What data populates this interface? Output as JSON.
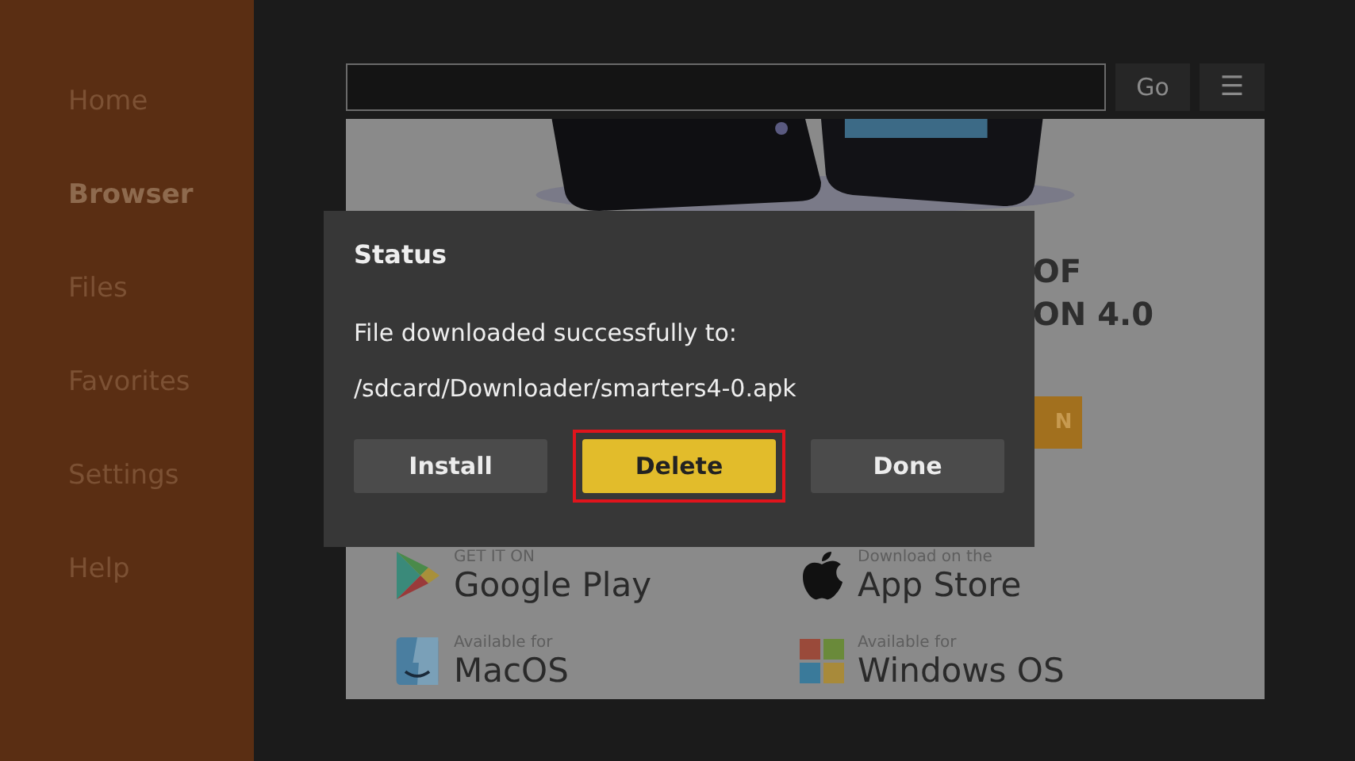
{
  "sidebar": {
    "items": [
      {
        "label": "Home",
        "selected": false
      },
      {
        "label": "Browser",
        "selected": true
      },
      {
        "label": "Files",
        "selected": false
      },
      {
        "label": "Favorites",
        "selected": false
      },
      {
        "label": "Settings",
        "selected": false
      },
      {
        "label": "Help",
        "selected": false
      }
    ]
  },
  "toolbar": {
    "go": "Go",
    "menu": "☰"
  },
  "web_page": {
    "heading_lines": [
      "OF",
      "ON 4.0"
    ],
    "cta": "N",
    "stores": [
      {
        "kind": "play",
        "small": "GET IT ON",
        "big": "Google Play"
      },
      {
        "kind": "apple",
        "small": "Download on the",
        "big": "App Store"
      },
      {
        "kind": "mac",
        "small": "Available for",
        "big": "MacOS"
      },
      {
        "kind": "windows",
        "small": "Available for",
        "big": "Windows OS"
      }
    ]
  },
  "dialog": {
    "title": "Status",
    "message": "File downloaded successfully to:",
    "path": "/sdcard/Downloader/smarters4-0.apk",
    "buttons": [
      {
        "label": "Install",
        "focused": false
      },
      {
        "label": "Delete",
        "focused": true
      },
      {
        "label": "Done",
        "focused": false
      }
    ]
  }
}
